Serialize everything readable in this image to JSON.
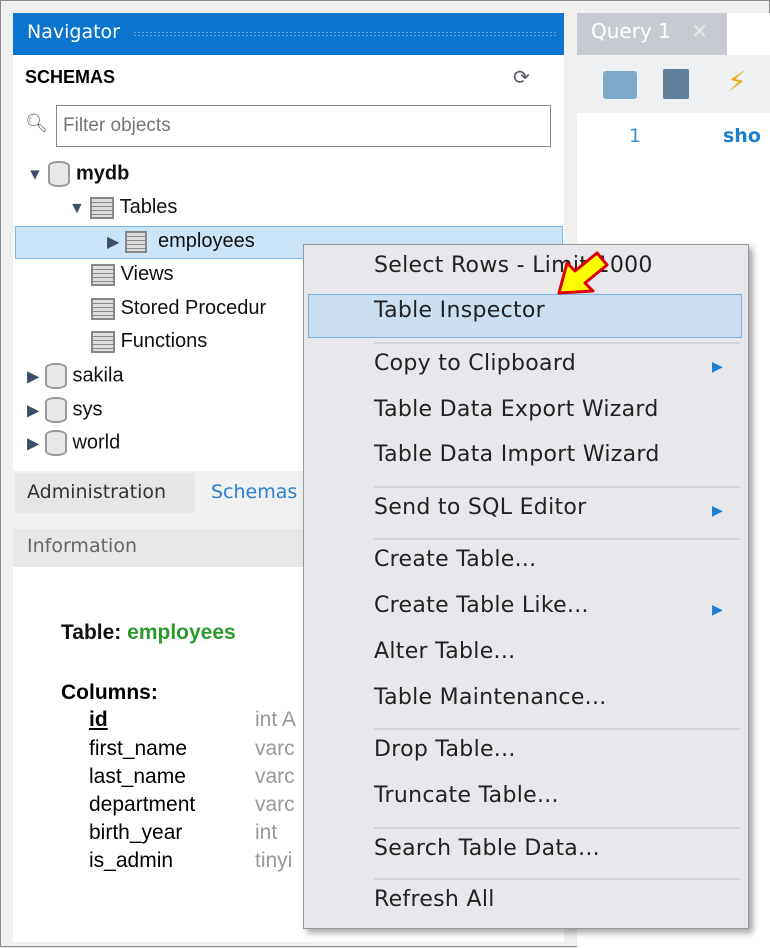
{
  "navigator": {
    "title": "Navigator",
    "schemas_label": "SCHEMAS",
    "filter_placeholder": "Filter objects",
    "tree": {
      "mydb": "mydb",
      "tables": "Tables",
      "employees": "employees",
      "views": "Views",
      "procedures": "Stored Procedur",
      "functions": "Functions",
      "sakila": "sakila",
      "sys": "sys",
      "world": "world"
    }
  },
  "bottom_tabs": {
    "administration": "Administration",
    "schemas": "Schemas"
  },
  "information": {
    "title": "Information",
    "table_label": "Table:",
    "table_name": "employees",
    "columns_label": "Columns:",
    "columns": [
      {
        "name": "id",
        "type": "int A"
      },
      {
        "name": "first_name",
        "type": "varc"
      },
      {
        "name": "last_name",
        "type": "varc"
      },
      {
        "name": "department",
        "type": "varc"
      },
      {
        "name": "birth_year",
        "type": "int"
      },
      {
        "name": "is_admin",
        "type": "tinyi"
      }
    ]
  },
  "query": {
    "tab": "Query 1",
    "line": "1",
    "code": "sho"
  },
  "menu": {
    "items": [
      "Select Rows - Limit 1000",
      "Table Inspector",
      "Copy to Clipboard",
      "Table Data Export Wizard",
      "Table Data Import Wizard",
      "Send to SQL Editor",
      "Create Table...",
      "Create Table Like...",
      "Alter Table...",
      "Table Maintenance...",
      "Drop Table...",
      "Truncate Table...",
      "Search Table Data...",
      "Refresh All"
    ]
  },
  "colors": {
    "accent": "#0a74cf",
    "highlight": "#ccdff0",
    "table_name": "#2a9a2a"
  }
}
